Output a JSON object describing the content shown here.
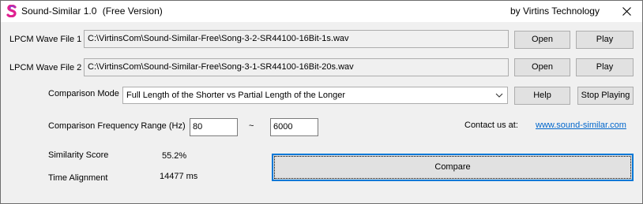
{
  "window": {
    "title": "Sound-Similar 1.0",
    "edition": "(Free Version)",
    "company": "by Virtins Technology",
    "close_icon": "close-icon"
  },
  "files": [
    {
      "label": "LPCM Wave File 1",
      "path": "C:\\VirtinsCom\\Sound-Similar-Free\\Song-3-2-SR44100-16Bit-1s.wav",
      "open_label": "Open",
      "play_label": "Play"
    },
    {
      "label": "LPCM Wave File 2",
      "path": "C:\\VirtinsCom\\Sound-Similar-Free\\Song-3-1-SR44100-16Bit-20s.wav",
      "open_label": "Open",
      "play_label": "Play"
    }
  ],
  "comparison": {
    "mode_label": "Comparison Mode",
    "mode_value": "Full Length of the Shorter vs Partial Length of the Longer",
    "help_label": "Help",
    "stop_label": "Stop Playing",
    "range_label": "Comparison Frequency Range (Hz)",
    "range_low": "80",
    "range_separator": "~",
    "range_high": "6000",
    "contact_label": "Contact us at:",
    "contact_link": "www.sound-similar.com"
  },
  "results": {
    "score_label": "Similarity Score",
    "score_value": "55.2%",
    "alignment_label": "Time Alignment",
    "alignment_value": "14477 ms",
    "compare_label": "Compare"
  },
  "colors": {
    "accent": "#0078d7",
    "link": "#0066cc",
    "icon_pink": "#e0208f",
    "icon_purple": "#8a3fd1"
  }
}
